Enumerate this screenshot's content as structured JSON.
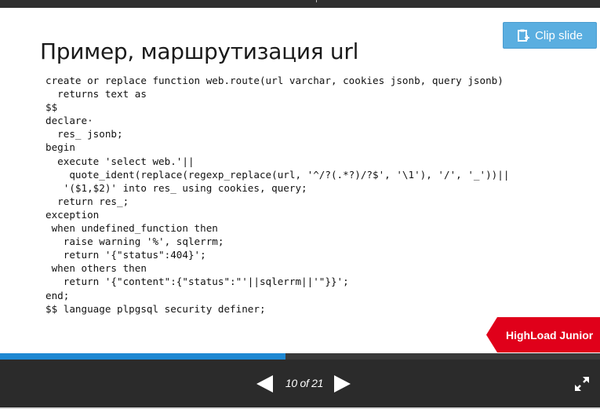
{
  "slide": {
    "title": "Пример, маршрутизация url",
    "code": "create or replace function web.route(url varchar, cookies jsonb, query jsonb)\n  returns text as\n$$\ndeclare·\n  res_ jsonb;\nbegin\n  execute 'select web.'||\n    quote_ident(replace(regexp_replace(url, '^/?(.*?)/?$', '\\1'), '/', '_'))||\n   '($1,$2)' into res_ using cookies, query;\n  return res_;\nexception\n when undefined_function then\n   raise warning '%', sqlerrm;\n   return '{\"status\":404}';\n when others then\n   return '{\"content\":{\"status\":\"'||sqlerrm||'\"}}';\nend;\n$$ language plpgsql security definer;",
    "brand_label": "HighLoad Junior",
    "brand_color": "#e0001a"
  },
  "toolbar": {
    "clip_label": "Clip slide",
    "clip_icon": "clipboard-plus-icon",
    "accent_color": "#5aaee0"
  },
  "player": {
    "page_label": "10 of 21",
    "current_page": 10,
    "total_pages": 21,
    "progress_fraction": 0.476,
    "progress_color": "#1e88d2",
    "prev_icon": "triangle-left-icon",
    "next_icon": "triangle-right-icon",
    "fullscreen_icon": "expand-arrows-icon"
  }
}
